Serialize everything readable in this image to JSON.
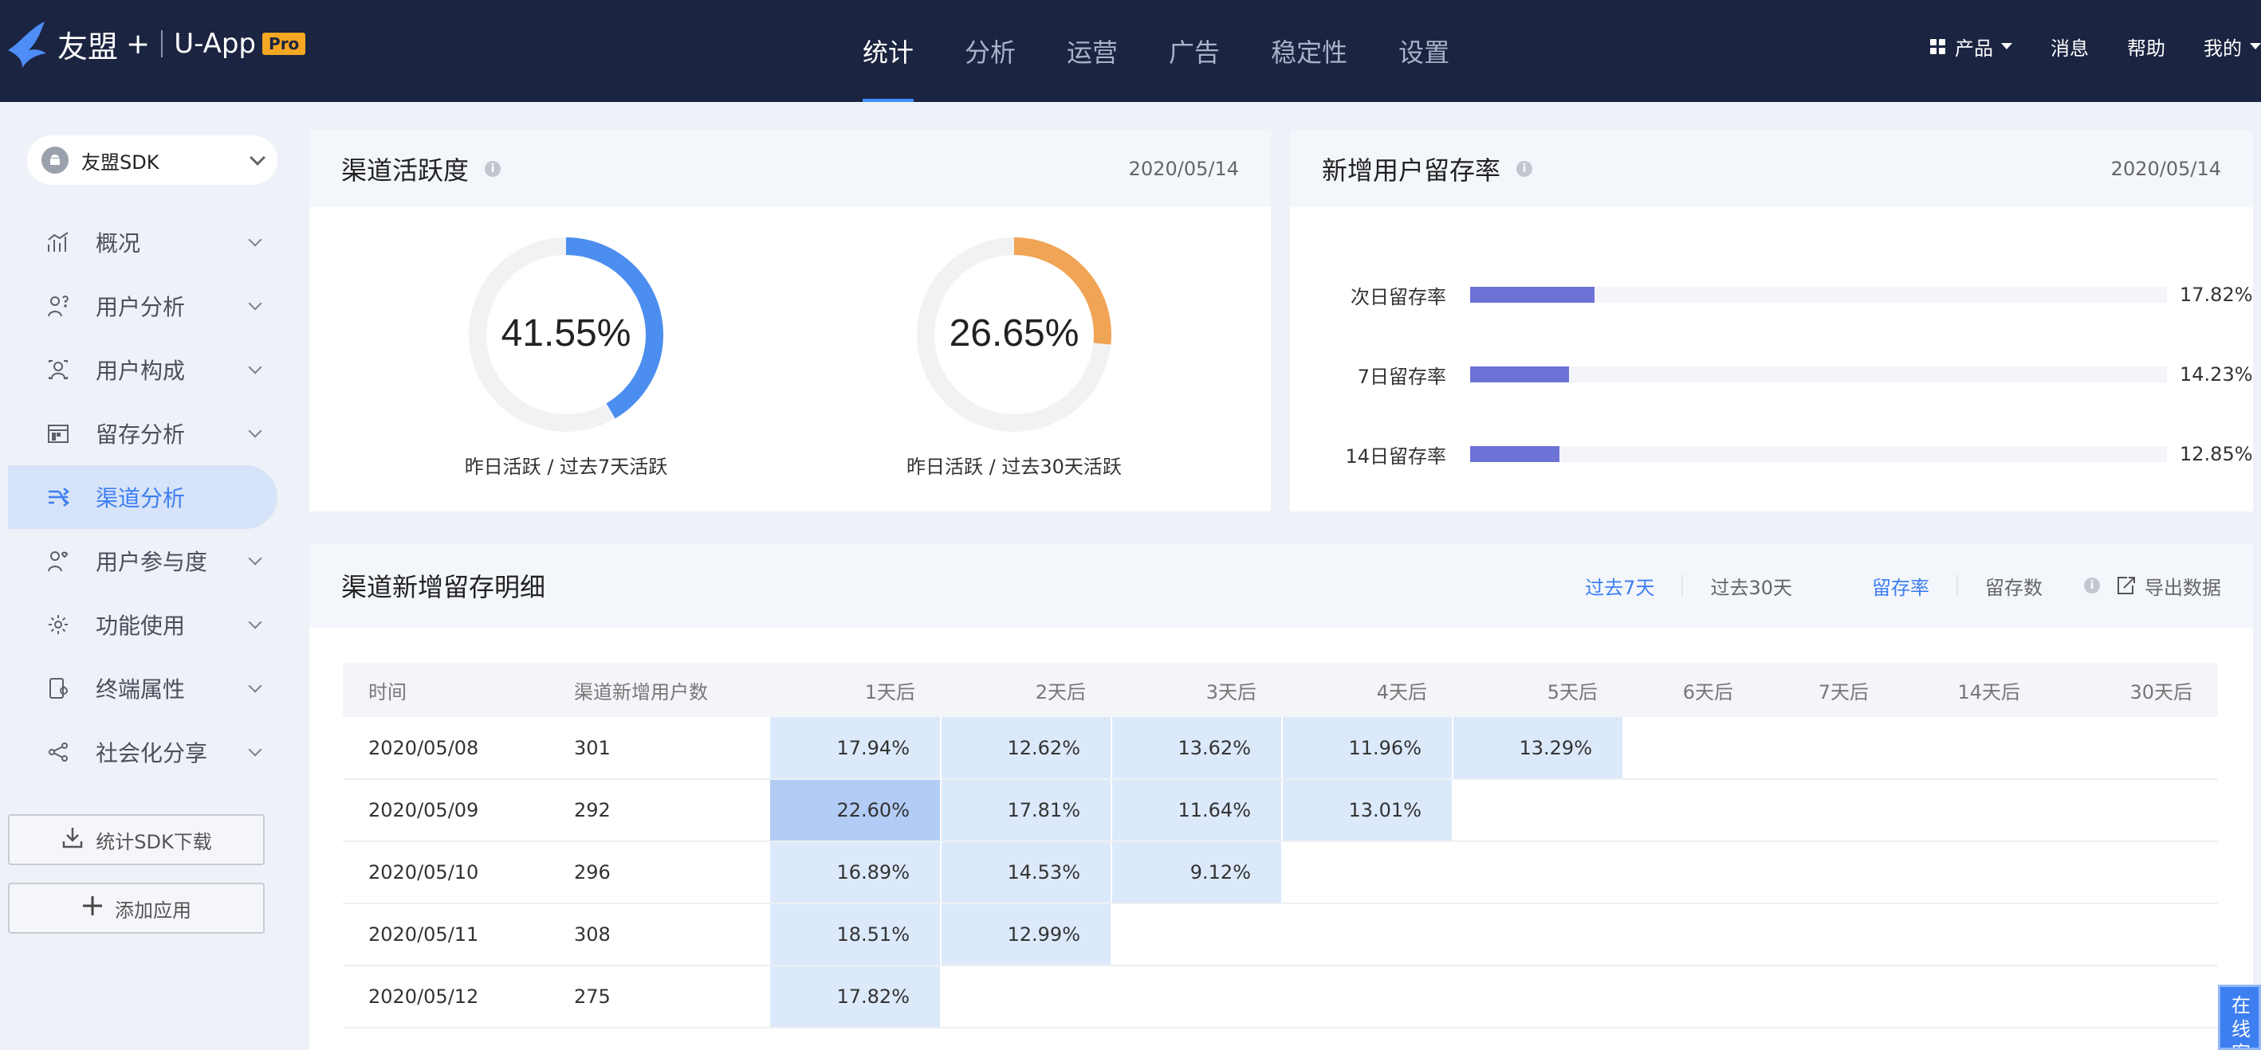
{
  "header": {
    "logo_brand": "友盟",
    "logo_plus": "+",
    "logo_product": "U-App",
    "logo_badge": "Pro",
    "tabs": [
      {
        "label": "统计",
        "active": true
      },
      {
        "label": "分析",
        "active": false
      },
      {
        "label": "运营",
        "active": false
      },
      {
        "label": "广告",
        "active": false
      },
      {
        "label": "稳定性",
        "active": false
      },
      {
        "label": "设置",
        "active": false
      }
    ],
    "right": {
      "products": "产品",
      "messages": "消息",
      "help": "帮助",
      "mine": "我的"
    }
  },
  "sidebar": {
    "app_name": "友盟SDK",
    "items": [
      {
        "label": "概况",
        "icon": "trend-chart-icon",
        "expandable": true
      },
      {
        "label": "用户分析",
        "icon": "user-question-icon",
        "expandable": true
      },
      {
        "label": "用户构成",
        "icon": "user-profile-icon",
        "expandable": true
      },
      {
        "label": "留存分析",
        "icon": "calendar-grid-icon",
        "expandable": true
      },
      {
        "label": "渠道分析",
        "icon": "channel-flow-icon",
        "expandable": false,
        "active": true
      },
      {
        "label": "用户参与度",
        "icon": "user-heart-icon",
        "expandable": true
      },
      {
        "label": "功能使用",
        "icon": "gear-icon",
        "expandable": true
      },
      {
        "label": "终端属性",
        "icon": "device-icon",
        "expandable": true
      },
      {
        "label": "社会化分享",
        "icon": "share-icon",
        "expandable": true
      }
    ],
    "download_label": "统计SDK下载",
    "add_app_label": "添加应用"
  },
  "activity_card": {
    "title": "渠道活跃度",
    "date": "2020/05/14",
    "donuts": [
      {
        "value_text": "41.55%",
        "value": 41.55,
        "color": "#4b8ef0",
        "label": "昨日活跃 / 过去7天活跃"
      },
      {
        "value_text": "26.65%",
        "value": 26.65,
        "color": "#f0a455",
        "label": "昨日活跃 / 过去30天活跃"
      }
    ]
  },
  "retention_card": {
    "title": "新增用户留存率",
    "date": "2020/05/14",
    "rows": [
      {
        "label": "次日留存率",
        "value_text": "17.82%",
        "value": 17.82
      },
      {
        "label": "7日留存率",
        "value_text": "14.23%",
        "value": 14.23
      },
      {
        "label": "14日留存率",
        "value_text": "12.85%",
        "value": 12.85
      }
    ],
    "bar_color": "#6d72d6",
    "scale_max": 100
  },
  "detail_card": {
    "title": "渠道新增留存明细",
    "filters": {
      "past7": "过去7天",
      "past30": "过去30天",
      "rate": "留存率",
      "count": "留存数",
      "export": "导出数据"
    },
    "columns": [
      "时间",
      "渠道新增用户数",
      "1天后",
      "2天后",
      "3天后",
      "4天后",
      "5天后",
      "6天后",
      "7天后",
      "14天后",
      "30天后"
    ],
    "rows": [
      {
        "date": "2020/05/08",
        "users": "301",
        "values": [
          "17.94%",
          "12.62%",
          "13.62%",
          "11.96%",
          "13.29%"
        ]
      },
      {
        "date": "2020/05/09",
        "users": "292",
        "values": [
          "22.60%",
          "17.81%",
          "11.64%",
          "13.01%"
        ]
      },
      {
        "date": "2020/05/10",
        "users": "296",
        "values": [
          "16.89%",
          "14.53%",
          "9.12%"
        ]
      },
      {
        "date": "2020/05/11",
        "users": "308",
        "values": [
          "18.51%",
          "12.99%"
        ]
      },
      {
        "date": "2020/05/12",
        "users": "275",
        "values": [
          "17.82%"
        ]
      }
    ]
  },
  "chat_button": "在线客服",
  "colors": {
    "accent": "#3d7ef0",
    "topbar": "#1b2440",
    "cell_light": "#dce9fb",
    "cell_strong": "#b2ccf6"
  }
}
